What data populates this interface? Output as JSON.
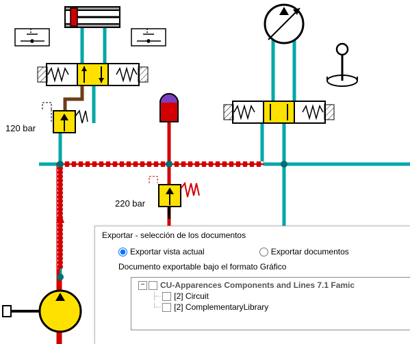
{
  "labels": {
    "pressure1": "120 bar",
    "pressure2": "220 bar"
  },
  "dialog": {
    "title": "Exportar - selección de los documentos",
    "option_current": "Exportar vista actual",
    "option_docs": "Exportar documentos",
    "subtitle": "Documento exportable bajo el formato Gráfico",
    "tree": {
      "root": "CU-Apparences Components and Lines 7.1 Famic",
      "item1": "[2] Circuit",
      "item2": "[2] ComplementaryLibrary"
    }
  }
}
